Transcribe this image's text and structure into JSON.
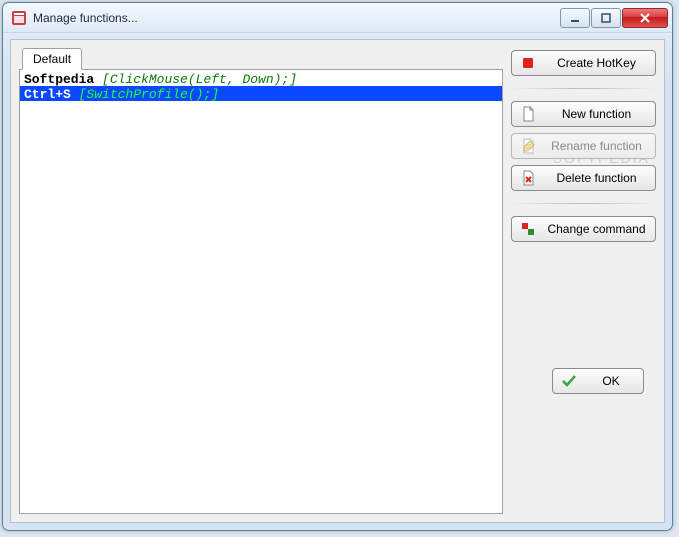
{
  "window": {
    "title": "Manage functions..."
  },
  "tabs": [
    {
      "label": "Default"
    }
  ],
  "functions": [
    {
      "name": "Softpedia",
      "command": "[ClickMouse(Left, Down);]",
      "selected": false
    },
    {
      "name": "Ctrl+S",
      "command": "[SwitchProfile();]",
      "selected": true
    }
  ],
  "buttons": {
    "create_hotkey": "Create HotKey",
    "new_function": "New function",
    "rename_function": "Rename function",
    "delete_function": "Delete function",
    "change_command": "Change command",
    "ok": "OK"
  },
  "watermark": "SOFTPEDIA"
}
